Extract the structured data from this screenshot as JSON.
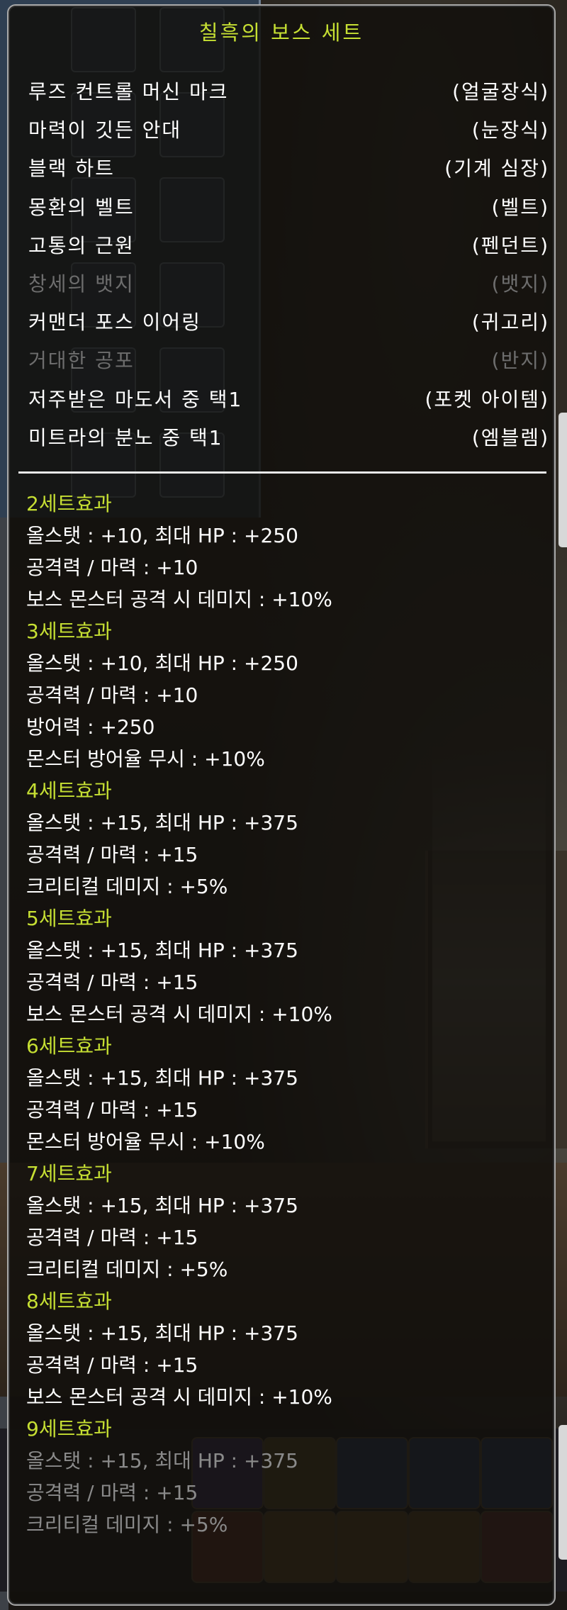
{
  "tooltip": {
    "title": "칠흑의 보스 세트",
    "items": [
      {
        "name": "루즈 컨트롤 머신 마크",
        "slot": "(얼굴장식)",
        "owned": true
      },
      {
        "name": "마력이 깃든 안대",
        "slot": "(눈장식)",
        "owned": true
      },
      {
        "name": "블랙 하트",
        "slot": "(기계 심장)",
        "owned": true
      },
      {
        "name": "몽환의 벨트",
        "slot": "(벨트)",
        "owned": true
      },
      {
        "name": "고통의 근원",
        "slot": "(펜던트)",
        "owned": true
      },
      {
        "name": "창세의 뱃지",
        "slot": "(뱃지)",
        "owned": false
      },
      {
        "name": "커맨더 포스 이어링",
        "slot": "(귀고리)",
        "owned": true
      },
      {
        "name": "거대한 공포",
        "slot": "(반지)",
        "owned": false
      },
      {
        "name": "저주받은 마도서 중 택1",
        "slot": "(포켓 아이템)",
        "owned": true
      },
      {
        "name": "미트라의 분노 중 택1",
        "slot": "(엠블렘)",
        "owned": true
      }
    ],
    "set_effects": [
      {
        "header": "2세트효과",
        "lines": [
          "올스탯 : +10, 최대 HP : +250",
          "공격력 / 마력 : +10",
          "보스 몬스터 공격 시 데미지 : +10%"
        ]
      },
      {
        "header": "3세트효과",
        "lines": [
          "올스탯 : +10, 최대 HP : +250",
          "공격력 / 마력 : +10",
          "방어력 : +250",
          "몬스터 방어율 무시 : +10%"
        ]
      },
      {
        "header": "4세트효과",
        "lines": [
          "올스탯 : +15, 최대 HP : +375",
          "공격력 / 마력 : +15",
          "크리티컬 데미지 : +5%"
        ]
      },
      {
        "header": "5세트효과",
        "lines": [
          "올스탯 : +15, 최대 HP : +375",
          "공격력 / 마력 : +15",
          "보스 몬스터 공격 시 데미지 : +10%"
        ]
      },
      {
        "header": "6세트효과",
        "lines": [
          "올스탯 : +15, 최대 HP : +375",
          "공격력 / 마력 : +15",
          "몬스터 방어율 무시 : +10%"
        ]
      },
      {
        "header": "7세트효과",
        "lines": [
          "올스탯 : +15, 최대 HP : +375",
          "공격력 / 마력 : +15",
          "크리티컬 데미지 : +5%"
        ]
      },
      {
        "header": "8세트효과",
        "lines": [
          "올스탯 : +15, 최대 HP : +375",
          "공격력 / 마력 : +15",
          "보스 몬스터 공격 시 데미지 : +10%"
        ]
      },
      {
        "header": "9세트효과",
        "lines": [
          "올스탯 : +15, 최대 HP : +375",
          "공격력 / 마력 : +15",
          "크리티컬 데미지 : +5%"
        ]
      }
    ]
  },
  "colors": {
    "title": "#c6df33",
    "set_header": "#c6df33",
    "owned_text": "#ffffff",
    "missing_text": "#6d6d6d",
    "panel_border": "#a9a9a9"
  }
}
